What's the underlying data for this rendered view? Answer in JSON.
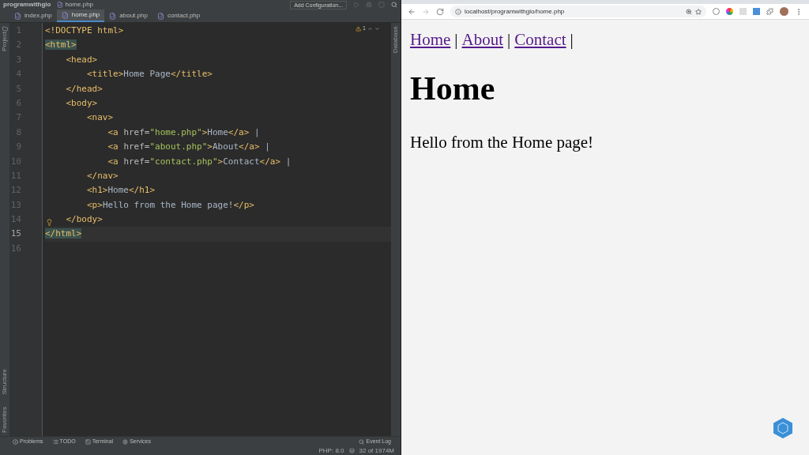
{
  "ide": {
    "project": "programwithgio",
    "breadcrumb": "home.php",
    "run_config": "Add Configuration...",
    "tabs": [
      {
        "label": "index.php",
        "selected": false
      },
      {
        "label": "home.php",
        "selected": true
      },
      {
        "label": "about.php",
        "selected": false
      },
      {
        "label": "contact.php",
        "selected": false
      }
    ],
    "left_tools": [
      "Project",
      "Structure",
      "Favorites"
    ],
    "right_tools": [
      "Database"
    ],
    "warning_count": "1",
    "lines": [
      {
        "number": "1",
        "current": false,
        "tokens": [
          {
            "kind": "tag",
            "text": "<!DOCTYPE html>"
          }
        ]
      },
      {
        "number": "2",
        "current": false,
        "tokens": [
          {
            "kind": "matched",
            "text": "<html>"
          }
        ],
        "children": [
          {
            "number": "3",
            "current": false,
            "tokens": [
              {
                "kind": "tag",
                "text": "<head>"
              }
            ],
            "children": [
              {
                "number": "4",
                "current": false,
                "tokens": [
                  {
                    "kind": "tag",
                    "text": "<title>"
                  },
                  {
                    "kind": "text",
                    "text": "Home Page"
                  },
                  {
                    "kind": "tag",
                    "text": "</title>"
                  }
                ]
              }
            ]
          },
          {
            "number": "5",
            "current": false,
            "tokens": [
              {
                "kind": "tag",
                "text": "</head>"
              }
            ]
          },
          {
            "number": "6",
            "current": false,
            "tokens": [
              {
                "kind": "tag",
                "text": "<body>"
              }
            ],
            "children": [
              {
                "number": "7",
                "current": false,
                "tokens": [
                  {
                    "kind": "tag",
                    "text": "<nav>"
                  }
                ],
                "children": [
                  {
                    "number": "8",
                    "current": false,
                    "tokens": [
                      {
                        "kind": "tag",
                        "text": "<a "
                      },
                      {
                        "kind": "attr",
                        "text": "href="
                      },
                      {
                        "kind": "string",
                        "text": "\"home.php\""
                      },
                      {
                        "kind": "tag",
                        "text": ">"
                      },
                      {
                        "kind": "text",
                        "text": "Home"
                      },
                      {
                        "kind": "tag",
                        "text": "</a>"
                      },
                      {
                        "kind": "text",
                        "text": " |"
                      }
                    ]
                  },
                  {
                    "number": "9",
                    "current": false,
                    "tokens": [
                      {
                        "kind": "tag",
                        "text": "<a "
                      },
                      {
                        "kind": "attr",
                        "text": "href="
                      },
                      {
                        "kind": "string",
                        "text": "\"about.php\""
                      },
                      {
                        "kind": "tag",
                        "text": ">"
                      },
                      {
                        "kind": "text",
                        "text": "About"
                      },
                      {
                        "kind": "tag",
                        "text": "</a>"
                      },
                      {
                        "kind": "text",
                        "text": " |"
                      }
                    ]
                  },
                  {
                    "number": "10",
                    "current": false,
                    "tokens": [
                      {
                        "kind": "tag",
                        "text": "<a "
                      },
                      {
                        "kind": "attr",
                        "text": "href="
                      },
                      {
                        "kind": "string",
                        "text": "\"contact.php\""
                      },
                      {
                        "kind": "tag",
                        "text": ">"
                      },
                      {
                        "kind": "text",
                        "text": "Contact"
                      },
                      {
                        "kind": "tag",
                        "text": "</a>"
                      },
                      {
                        "kind": "text",
                        "text": " |"
                      }
                    ]
                  }
                ]
              },
              {
                "number": "11",
                "current": false,
                "tokens": [
                  {
                    "kind": "tag",
                    "text": "</nav>"
                  }
                ]
              },
              {
                "number": "12",
                "current": false,
                "tokens": [
                  {
                    "kind": "tag",
                    "text": "<h1>"
                  },
                  {
                    "kind": "text",
                    "text": "Home"
                  },
                  {
                    "kind": "tag",
                    "text": "</h1>"
                  }
                ]
              },
              {
                "number": "13",
                "current": false,
                "tokens": [
                  {
                    "kind": "tag",
                    "text": "<p>"
                  },
                  {
                    "kind": "text",
                    "text": "Hello from the Home page!"
                  },
                  {
                    "kind": "tag",
                    "text": "</p>"
                  }
                ]
              }
            ]
          },
          {
            "number": "14",
            "current": false,
            "tokens": [
              {
                "kind": "tag",
                "text": "</body>"
              }
            ]
          }
        ]
      },
      {
        "number": "15",
        "current": true,
        "tokens": [
          {
            "kind": "matched",
            "text": "</html>"
          }
        ]
      },
      {
        "number": "16",
        "current": false
      }
    ],
    "tool_windows": [
      "Problems",
      "TODO",
      "Terminal",
      "Services"
    ],
    "event_log": "Event Log",
    "php_version": "PHP: 8.0",
    "memory": "32 of 1974M"
  },
  "browser": {
    "url": "localhost/programwithgio/home.php",
    "nav": [
      {
        "label": "Home",
        "separator": "|"
      },
      {
        "label": "About",
        "separator": "|"
      },
      {
        "label": "Contact",
        "separator": "|"
      }
    ],
    "heading": "Home",
    "paragraph": "Hello from the Home page!"
  }
}
